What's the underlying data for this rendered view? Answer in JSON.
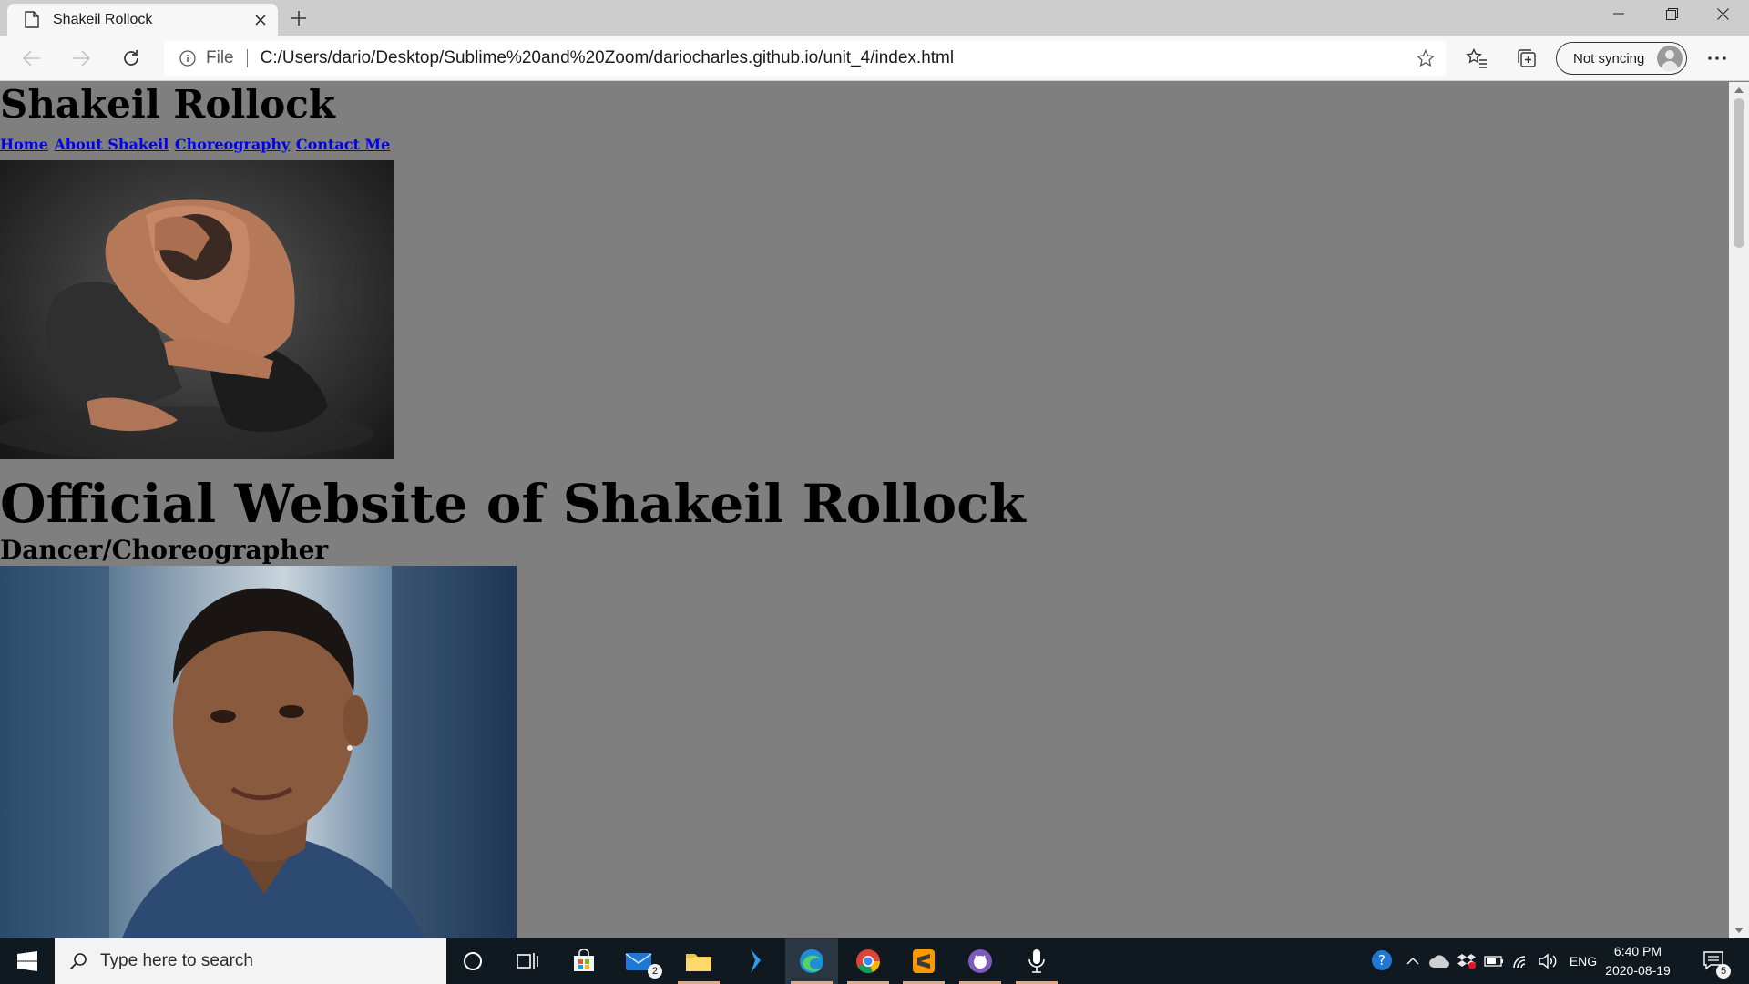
{
  "browser": {
    "tab_title": "Shakeil Rollock",
    "address_scheme": "File",
    "address_url": "C:/Users/dario/Desktop/Sublime%20and%20Zoom/dariocharles.github.io/unit_4/index.html",
    "sync_label": "Not syncing"
  },
  "page": {
    "site_title": "Shakeil Rollock",
    "nav": [
      "Home",
      "About Shakeil",
      "Choreography",
      "Contact Me"
    ],
    "main_heading": "Official Website of Shakeil Rollock",
    "sub_heading": "Dancer/Choreographer"
  },
  "taskbar": {
    "search_placeholder": "Type here to search",
    "mail_badge": "2",
    "language": "ENG",
    "time": "6:40 PM",
    "date": "2020-08-19",
    "notification_count": "5"
  },
  "colors": {
    "page_background": "#7f7f7f",
    "link": "#0000ee",
    "taskbar": "#101820"
  }
}
